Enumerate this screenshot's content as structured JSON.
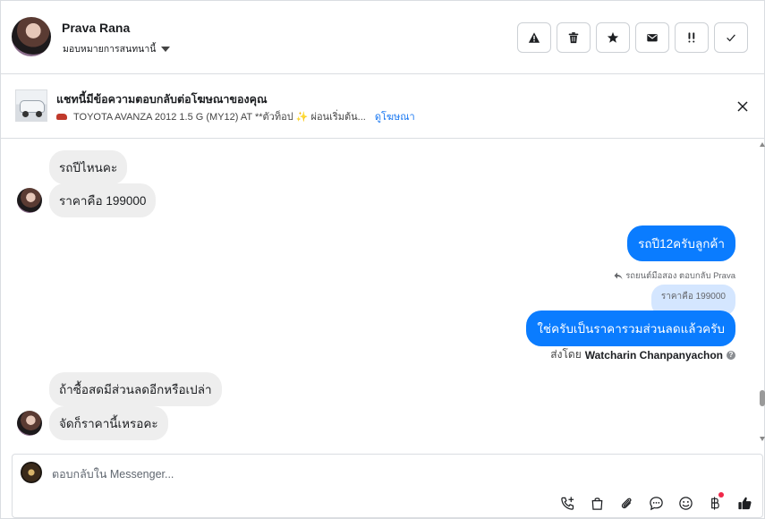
{
  "header": {
    "contact_name": "Prava Rana",
    "assign_label": "มอบหมายการสนทนานี้",
    "actions": [
      "warning-icon",
      "trash-icon",
      "star-icon",
      "envelope-icon",
      "follow-up-icon",
      "check-icon"
    ]
  },
  "ad": {
    "title": "แชทนี้มีข้อความตอบกลับต่อโฆษณาของคุณ",
    "description": "TOYOTA AVANZA 2012 1.5 G (MY12) AT **ตัวท็อป ✨ ผ่อนเริ่มต้น...",
    "link": "ดูโฆษณา"
  },
  "messages": {
    "in1": "รถปีไหนคะ",
    "in2": "ราคาคือ 199000",
    "out1": "รถปี12ครับลูกค้า",
    "reply_meta": "รถยนต์มือสอง ตอบกลับ Prava",
    "quoted": "ราคาคือ 199000",
    "out2": "ใช่ครับเป็นราคารวมส่วนลดแล้วครับ",
    "sent_by_prefix": "ส่งโดย",
    "sent_by_name": "Watcharin Chanpanyachon",
    "in3": "ถ้าซื้อสดมีส่วนลดอีกหรือเปล่า",
    "in4": "จัดก็ราคานี้เหรอคะ"
  },
  "composer": {
    "placeholder": "ตอบกลับใน Messenger...",
    "tools": [
      "call-add-icon",
      "shopping-bag-icon",
      "attachment-icon",
      "saved-reply-icon",
      "emoji-icon",
      "baht-icon",
      "like-icon"
    ]
  },
  "colors": {
    "outgoing_bubble": "#0a7cff",
    "incoming_bubble": "#eeeeee",
    "quoted_bubble": "#d4e6ff",
    "link": "#1877f2",
    "notification_dot": "#f02849"
  }
}
